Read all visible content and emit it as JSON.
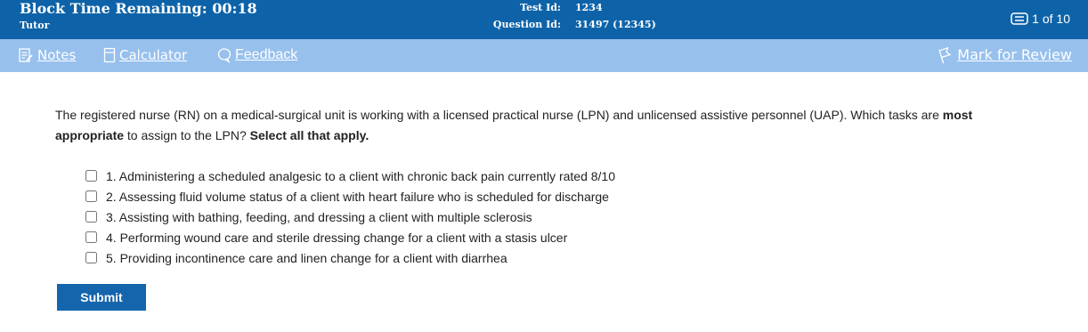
{
  "header": {
    "block_time": "Block Time Remaining: 00:18",
    "mode": "Tutor",
    "test_id_label": "Test Id:",
    "test_id_value": "1234",
    "question_id_label": "Question Id:",
    "question_id_value": "31497 (12345)",
    "page_count": "1 of 10"
  },
  "toolbar": {
    "notes": "Notes",
    "calculator": "Calculator",
    "feedback": "Feedback",
    "mark_for_review": "Mark for Review"
  },
  "question": {
    "stem_part1": "The registered nurse (RN) on a medical-surgical unit is working with a licensed practical nurse (LPN) and unlicensed assistive personnel (UAP).  Which tasks are ",
    "stem_bold1": "most appropriate",
    "stem_part2": " to assign to the LPN?  ",
    "stem_bold2": "Select all that apply."
  },
  "options": [
    {
      "label": "1. Administering a scheduled analgesic to a client with chronic back pain currently rated 8/10",
      "checked": false
    },
    {
      "label": "2. Assessing fluid volume status of a client with heart failure who is scheduled for discharge",
      "checked": false
    },
    {
      "label": "3. Assisting with bathing, feeding, and dressing a client with multiple sclerosis",
      "checked": false
    },
    {
      "label": "4. Performing wound care and sterile dressing change for a client with a stasis ulcer",
      "checked": false
    },
    {
      "label": "5. Providing incontinence care and linen change for a client with diarrhea",
      "checked": false
    }
  ],
  "submit_label": "Submit",
  "colors": {
    "header_bg": "#0e63a8",
    "toolbar_bg": "#97c0ed",
    "submit_bg": "#1565ad"
  }
}
